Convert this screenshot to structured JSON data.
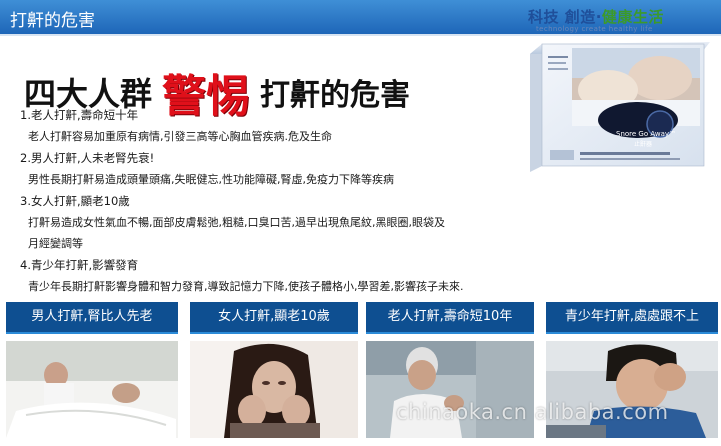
{
  "header": {
    "title": "打鼾的危害",
    "brand_main": "科技 創造·",
    "brand_green": "健康生活",
    "brand_sub": "technology create healthy life"
  },
  "headline": {
    "part1": "四大人群",
    "highlight": "警惕",
    "part2": "打鼾的危害"
  },
  "product": {
    "box_label": "Snore Go Away™",
    "box_sublabel": "止鼾器"
  },
  "sections": [
    {
      "title": "1.老人打鼾,壽命短十年",
      "lines": [
        "老人打鼾容易加重原有病情,引發三高等心胸血管疾病.危及生命"
      ]
    },
    {
      "title": "2.男人打鼾,人未老腎先衰!",
      "lines": [
        "男性長期打鼾易造成頭暈頭痛,失眠健忘,性功能障礙,腎虛,免疫力下降等疾病"
      ]
    },
    {
      "title": "3.女人打鼾,顯老10歲",
      "lines": [
        "打鼾易造成女性氣血不暢,面部皮膚鬆弛,粗糙,口臭口苦,過早出現魚尾紋,黑眼圈,眼袋及",
        "月經變調等"
      ]
    },
    {
      "title": "4.青少年打鼾,影響發育",
      "lines": [
        "青少年長期打鼾影響身體和智力發育,導致記憶力下降,使孩子體格小,學習差,影響孩子未來."
      ]
    }
  ],
  "panels": [
    {
      "label": "男人打鼾,腎比人先老",
      "photo": "couple-in-bed"
    },
    {
      "label": "女人打鼾,顯老10歲",
      "photo": "tired-woman"
    },
    {
      "label": "老人打鼾,壽命短10年",
      "photo": "elderly-man"
    },
    {
      "label": "青少年打鼾,處處跟不上",
      "photo": "teen-boy-headache"
    }
  ],
  "watermark": "chinaoka.cn alibaba.com",
  "colors": {
    "header_blue": "#1e66b8",
    "panel_blue": "#0e4f91",
    "accent_red": "#e0101a",
    "brand_green": "#3c9a2a"
  }
}
